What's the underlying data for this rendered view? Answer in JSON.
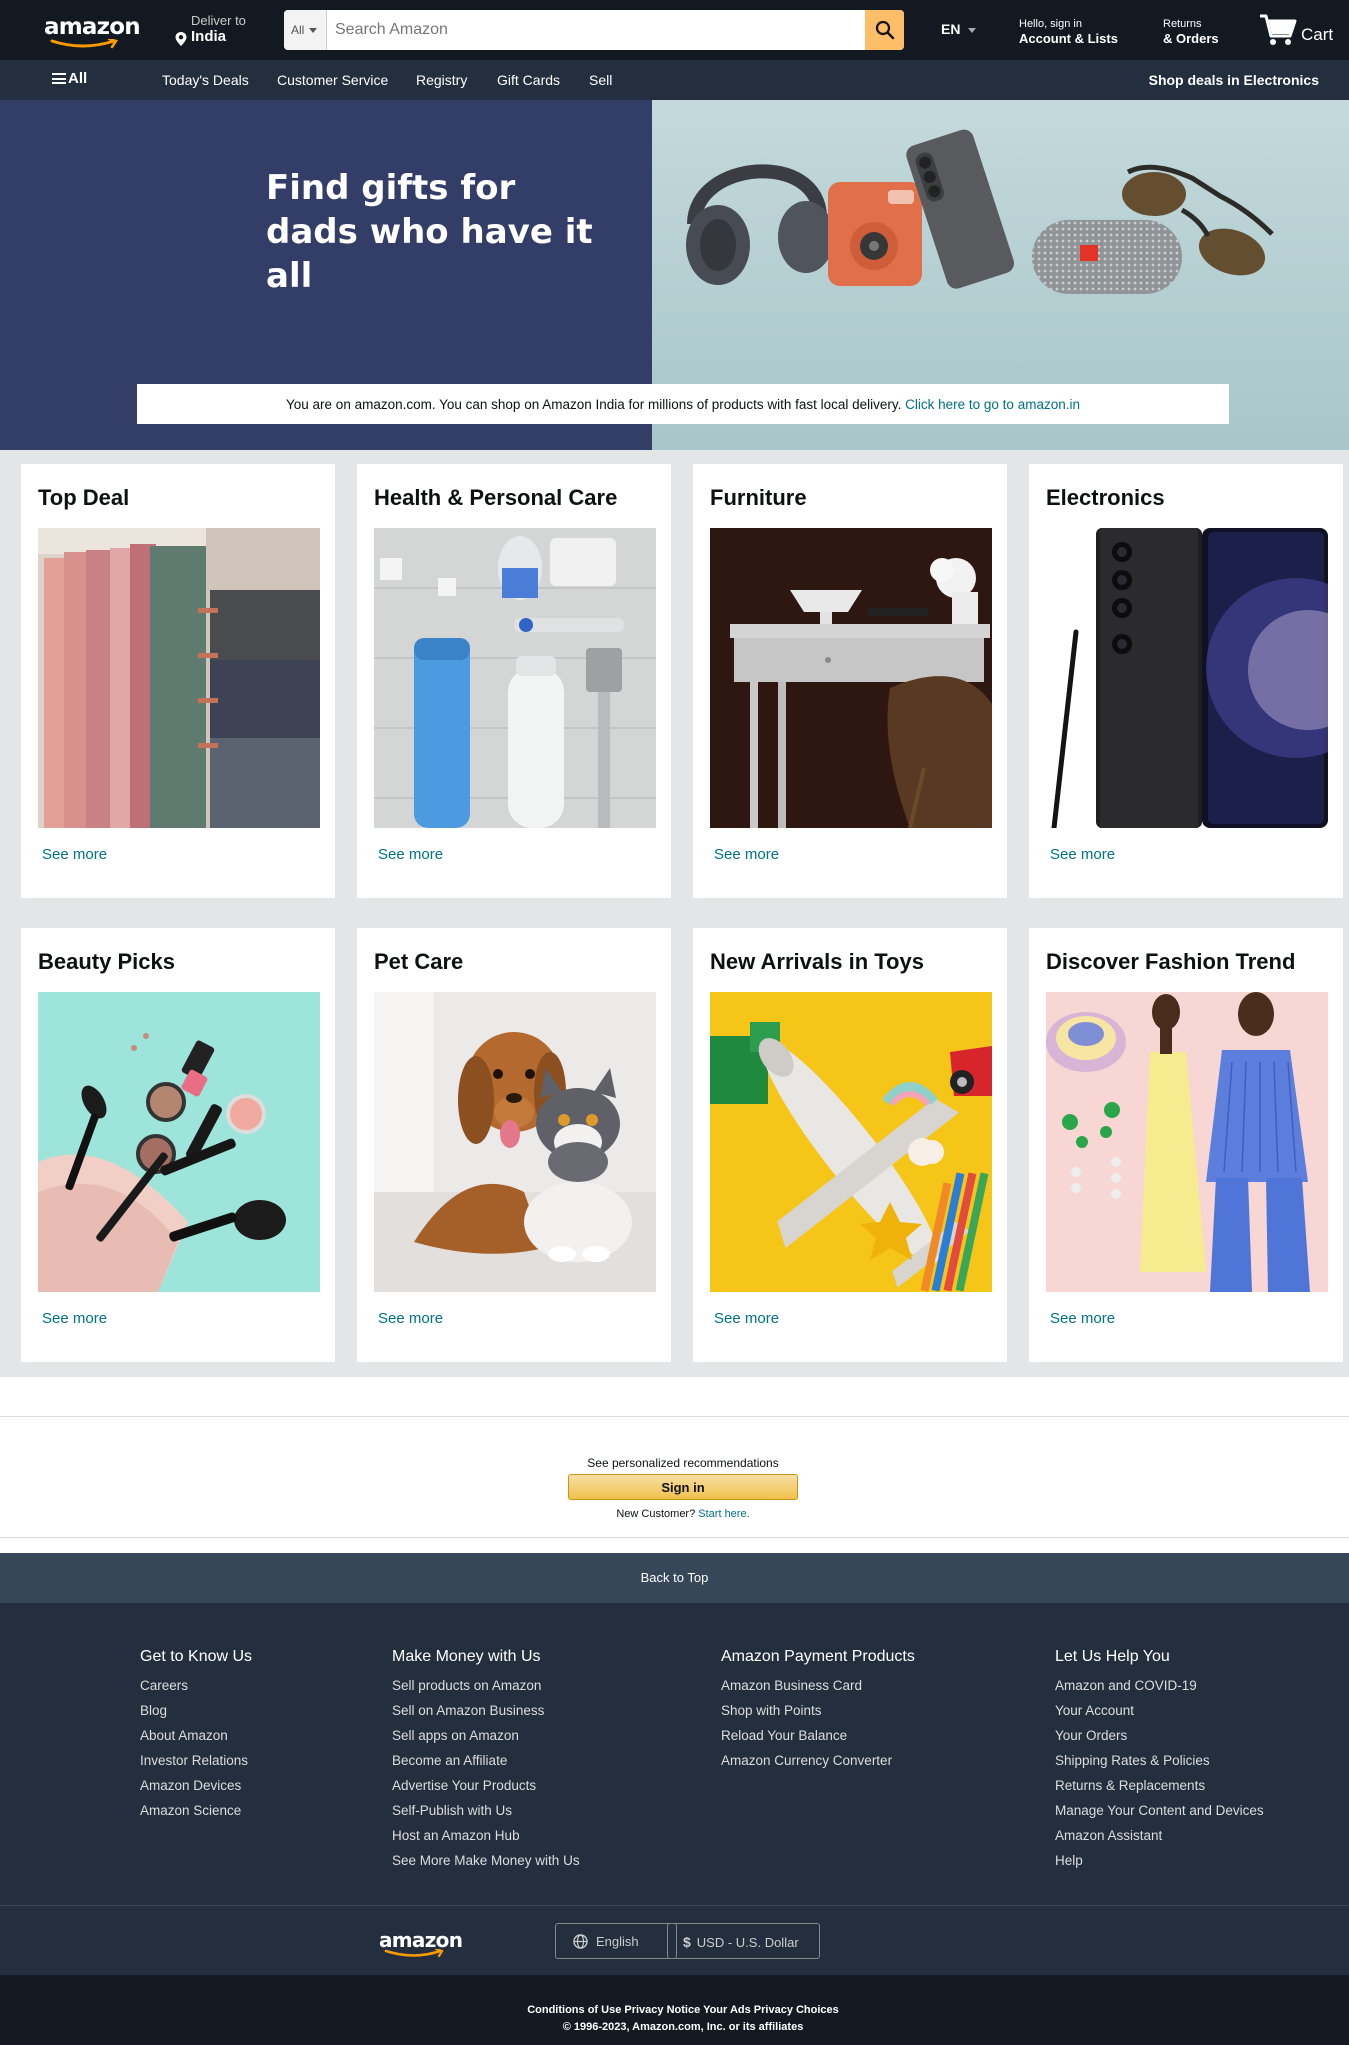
{
  "header": {
    "logo_text": "amazon",
    "deliver_label": "Deliver to",
    "deliver_location": "India",
    "search_category": "All",
    "search_placeholder": "Search Amazon",
    "language": "EN",
    "account_line1": "Hello, sign in",
    "account_line2": "Account & Lists",
    "returns_line1": "Returns",
    "returns_line2": "& Orders",
    "cart_label": "Cart"
  },
  "subnav": {
    "all_label": "All",
    "items": [
      "Today's Deals",
      "Customer Service",
      "Registry",
      "Gift Cards",
      "Sell"
    ],
    "promo": "Shop deals in Electronics"
  },
  "hero": {
    "title_line1": "Find gifts for",
    "title_line2": "dads who have it all",
    "notice_text": "You are on amazon.com. You can shop on Amazon India for millions of products with fast local delivery.",
    "notice_link": "Click here to go to amazon.in"
  },
  "cards": [
    {
      "title": "Top Deal",
      "link": "See more"
    },
    {
      "title": "Health & Personal Care",
      "link": "See more"
    },
    {
      "title": "Furniture",
      "link": "See more"
    },
    {
      "title": "Electronics",
      "link": "See more"
    },
    {
      "title": "Beauty Picks",
      "link": "See more"
    },
    {
      "title": "Pet Care",
      "link": "See more"
    },
    {
      "title": "New Arrivals in Toys",
      "link": "See more"
    },
    {
      "title": "Discover Fashion Trend",
      "link": "See more"
    }
  ],
  "signin": {
    "prompt": "See personalized recommendations",
    "button": "Sign in",
    "new_customer": "New Customer?",
    "start_here": "Start here."
  },
  "footer": {
    "back_to_top": "Back to Top",
    "columns": [
      {
        "heading": "Get to Know Us",
        "links": [
          "Careers",
          "Blog",
          "About Amazon",
          "Investor Relations",
          "Amazon Devices",
          "Amazon Science"
        ]
      },
      {
        "heading": "Make Money with Us",
        "links": [
          "Sell products on Amazon",
          "Sell on Amazon Business",
          "Sell apps on Amazon",
          "Become an Affiliate",
          "Advertise Your Products",
          "Self-Publish with Us",
          "Host an Amazon Hub",
          "See More Make Money with Us"
        ]
      },
      {
        "heading": "Amazon Payment Products",
        "links": [
          "Amazon Business Card",
          "Shop with Points",
          "Reload Your Balance",
          "Amazon Currency Converter"
        ]
      },
      {
        "heading": "Let Us Help You",
        "links": [
          "Amazon and COVID-19",
          "Your Account",
          "Your Orders",
          "Shipping Rates & Policies",
          "Returns & Replacements",
          "Manage Your Content and Devices",
          "Amazon Assistant",
          "Help"
        ]
      }
    ],
    "logo_text": "amazon",
    "language_button": "English",
    "currency_button": "USD - U.S. Dollar",
    "legal_links": [
      "Conditions of Use",
      "Privacy Notice",
      "Your Ads Privacy Choices"
    ],
    "copyright": "© 1996-2023, Amazon.com, Inc. or its affiliates"
  },
  "colors": {
    "nav_dark": "#131921",
    "nav_sub": "#232f3e",
    "accent_orange": "#febd69",
    "link_teal": "#007185",
    "hero_navy": "#323e67"
  }
}
